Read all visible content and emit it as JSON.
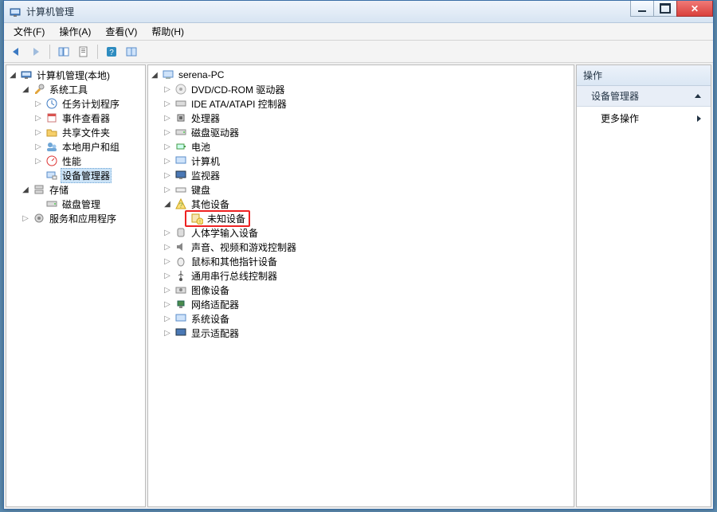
{
  "window": {
    "title": "计算机管理"
  },
  "menu": {
    "file": "文件(F)",
    "action": "操作(A)",
    "view": "查看(V)",
    "help": "帮助(H)"
  },
  "left_tree": {
    "root": "计算机管理(本地)",
    "system_tools": "系统工具",
    "task_scheduler": "任务计划程序",
    "event_viewer": "事件查看器",
    "shared_folders": "共享文件夹",
    "local_users": "本地用户和组",
    "performance": "性能",
    "device_manager": "设备管理器",
    "storage": "存储",
    "disk_management": "磁盘管理",
    "services_apps": "服务和应用程序"
  },
  "device_tree": {
    "computer_name": "serena-PC",
    "dvd_cdrom": "DVD/CD-ROM 驱动器",
    "ide_atapi": "IDE ATA/ATAPI 控制器",
    "processors": "处理器",
    "disk_drives": "磁盘驱动器",
    "batteries": "电池",
    "computer": "计算机",
    "monitors": "监视器",
    "keyboards": "键盘",
    "other_devices": "其他设备",
    "unknown_device": "未知设备",
    "hid": "人体学输入设备",
    "sound_video": "声音、视频和游戏控制器",
    "mice": "鼠标和其他指针设备",
    "usb": "通用串行总线控制器",
    "imaging": "图像设备",
    "network": "网络适配器",
    "system": "系统设备",
    "display": "显示适配器"
  },
  "actions": {
    "header": "操作",
    "group": "设备管理器",
    "more": "更多操作"
  }
}
